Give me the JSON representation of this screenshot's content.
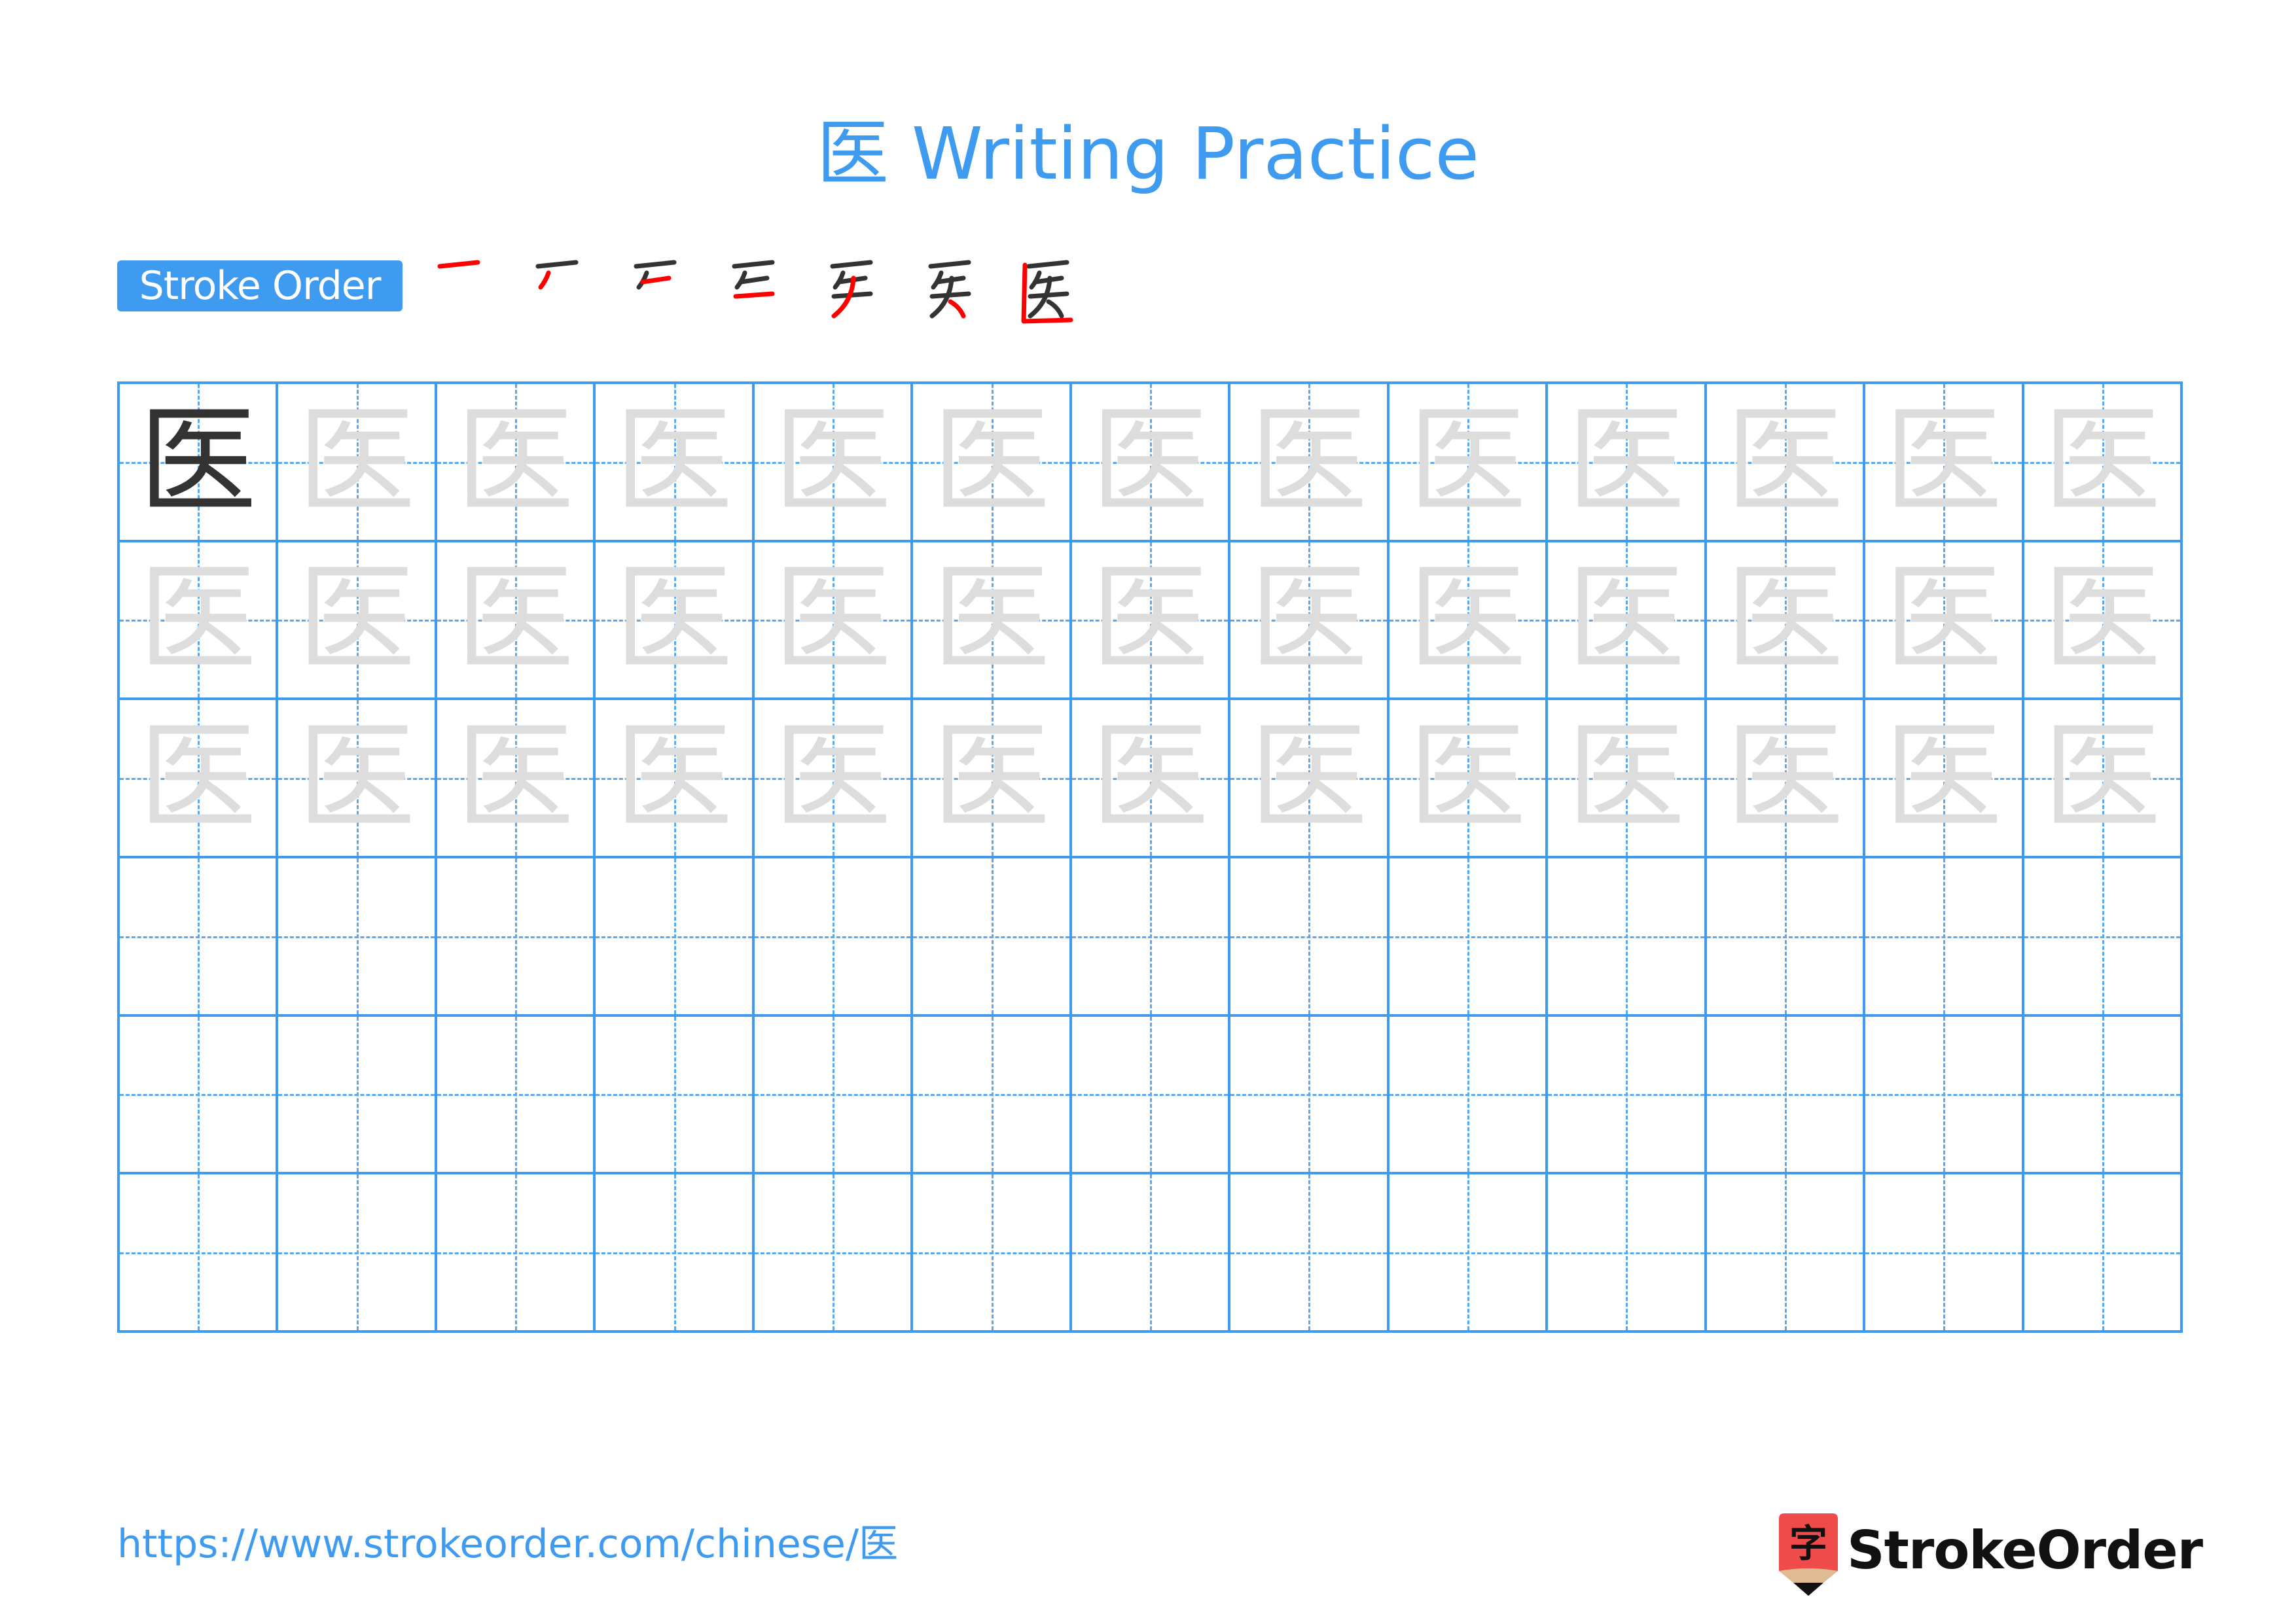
{
  "title": "医 Writing Practice",
  "character": "医",
  "stroke_order": {
    "label": "Stroke Order",
    "step_count": 7,
    "colors": {
      "done": "#333333",
      "current": "#ff0000"
    }
  },
  "grid": {
    "rows": 6,
    "cols": 13,
    "model_cells": 1,
    "trace_rows": 3,
    "colors": {
      "border": "#3f9bef",
      "guide": "#5aa8f0",
      "model": "#333333",
      "trace": "#dddddd"
    }
  },
  "footer": {
    "url": "https://www.strokeorder.com/chinese/医",
    "logo_text": "StrokeOrder",
    "logo_glyph": "字"
  },
  "colors": {
    "accent": "#3f9bef",
    "logo_red": "#ef4b4b",
    "logo_tan": "#dfbb94"
  }
}
